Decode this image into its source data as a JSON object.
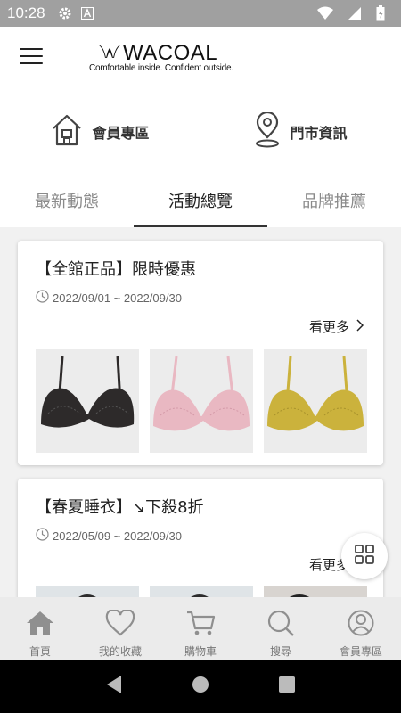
{
  "status_bar": {
    "time": "10:28"
  },
  "header": {
    "brand": "WACOAL",
    "tagline": "Comfortable inside. Confident outside."
  },
  "quick_links": [
    {
      "label": "會員專區",
      "icon": "house-icon"
    },
    {
      "label": "門市資訊",
      "icon": "location-pin-icon"
    }
  ],
  "tabs": [
    {
      "label": "最新動態",
      "active": false
    },
    {
      "label": "活動總覽",
      "active": true
    },
    {
      "label": "品牌推薦",
      "active": false
    }
  ],
  "cards": [
    {
      "title": "【全館正品】限時優惠",
      "date_range": "2022/09/01 ~ 2022/09/30",
      "more_label": "看更多",
      "thumbnails": [
        {
          "name": "black-lace-bra",
          "color": "#2d2a2a"
        },
        {
          "name": "pink-lace-bra",
          "color": "#e9b8c2"
        },
        {
          "name": "yellow-lace-bra",
          "color": "#cbb23c"
        }
      ]
    },
    {
      "title": "【春夏睡衣】↘下殺8折",
      "date_range": "2022/05/09 ~ 2022/09/30",
      "more_label": "看更多",
      "thumbnails": [
        {
          "name": "sleepwear-photo-1"
        },
        {
          "name": "sleepwear-photo-2"
        },
        {
          "name": "sleepwear-photo-3"
        }
      ]
    }
  ],
  "bottom_nav": [
    {
      "label": "首頁",
      "icon": "home-icon",
      "active": true
    },
    {
      "label": "我的收藏",
      "icon": "heart-icon",
      "active": false
    },
    {
      "label": "購物車",
      "icon": "cart-icon",
      "active": false
    },
    {
      "label": "搜尋",
      "icon": "search-icon",
      "active": false
    },
    {
      "label": "會員專區",
      "icon": "user-icon",
      "active": false
    }
  ],
  "colors": {
    "nav_bg": "#ebebeb",
    "icon_grey": "#8f8f8f",
    "status_bar": "#a0a0a0"
  }
}
